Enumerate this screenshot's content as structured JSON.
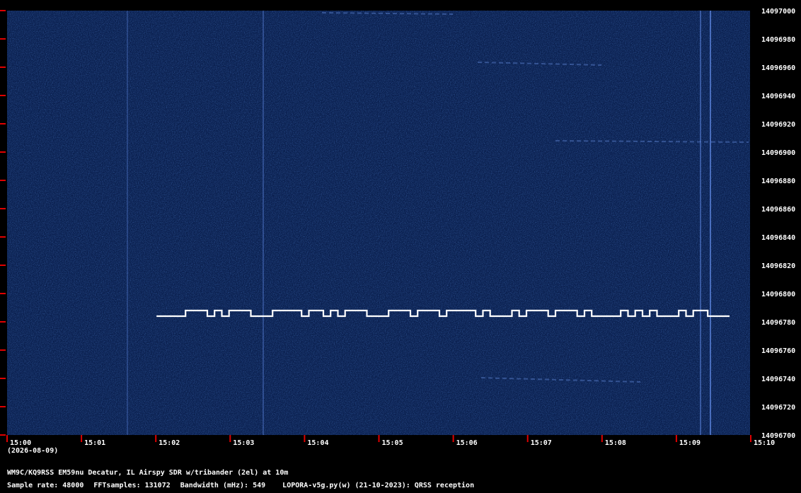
{
  "chart_data": {
    "type": "heatmap",
    "title": "",
    "xlabel": "",
    "ylabel": "",
    "x_tick_labels": [
      "15:00",
      "15:01",
      "15:02",
      "15:03",
      "15:04",
      "15:05",
      "15:06",
      "15:07",
      "15:08",
      "15:09",
      "15:10"
    ],
    "x_date_label": "(2026-08-09)",
    "y_tick_labels": [
      "14097000",
      "14096980",
      "14096960",
      "14096940",
      "14096920",
      "14096900",
      "14096880",
      "14096860",
      "14096840",
      "14096820",
      "14096800",
      "14096780",
      "14096760",
      "14096740",
      "14096720",
      "14096700"
    ],
    "ylim": [
      14096700,
      14097000
    ],
    "xlim": [
      "15:00",
      "15:10"
    ],
    "signal": {
      "description_freq_low": 14096780,
      "description_freq_high": 14096785,
      "start_time": "15:02",
      "end_time": "15:10",
      "bits": [
        0,
        0,
        0,
        0,
        1,
        1,
        1,
        0,
        1,
        0,
        1,
        1,
        1,
        0,
        0,
        0,
        1,
        1,
        1,
        1,
        0,
        1,
        1,
        0,
        1,
        0,
        1,
        1,
        1,
        0,
        0,
        0,
        1,
        1,
        1,
        0,
        1,
        1,
        1,
        0,
        1,
        1,
        1,
        1,
        0,
        1,
        0,
        0,
        0,
        1,
        0,
        1,
        1,
        1,
        0,
        1,
        1,
        1,
        0,
        1,
        0,
        0,
        0,
        0,
        1,
        0,
        1,
        0,
        1,
        0,
        0,
        0,
        1,
        0,
        1,
        1,
        0,
        0,
        0
      ]
    },
    "colors": {
      "background": "#0a1f4e",
      "noise": "#1d3a7a",
      "signal": "#ffffff",
      "tick": "#e00000",
      "axis_text": "#ffffff"
    }
  },
  "footer": {
    "station": "WM9C/KQ9RSS EM59nu Decatur, IL  Airspy SDR w/tribander (2el) at 10m",
    "sample_rate": "Sample rate: 48000",
    "fft_samples": "FFTsamples: 131072",
    "bandwidth": "Bandwidth (mHz): 549",
    "software": "LOPORA-v5g.py(w) (21-10-2023): QRSS reception"
  }
}
